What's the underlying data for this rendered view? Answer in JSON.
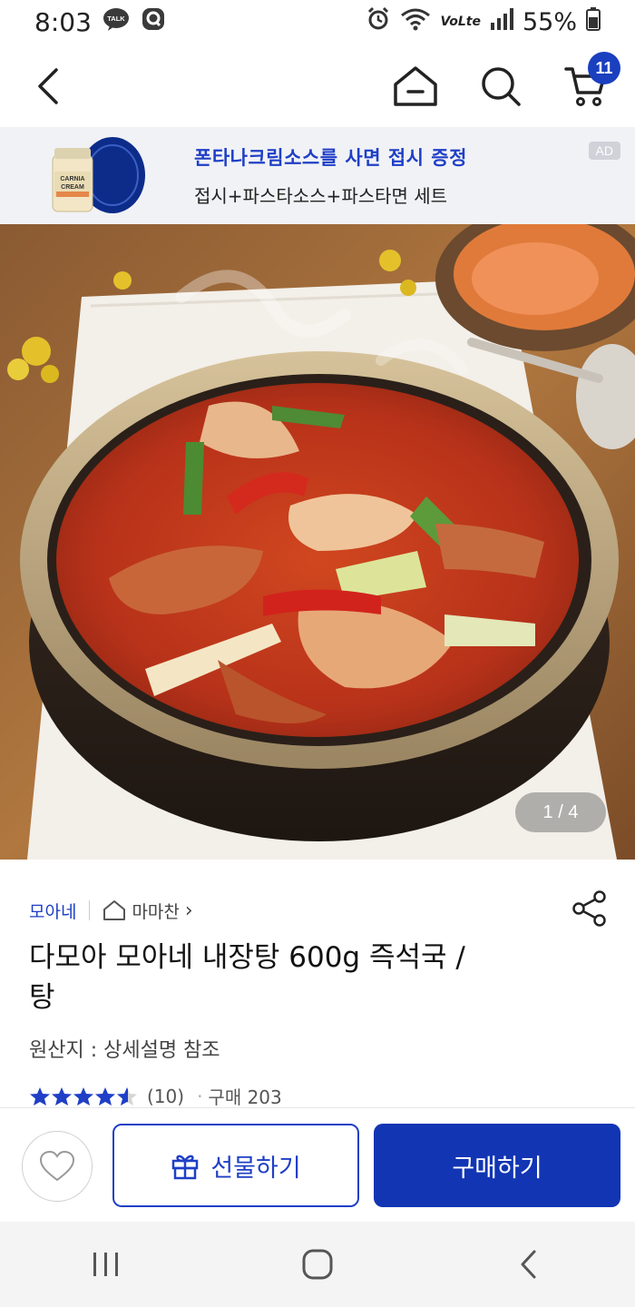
{
  "status_bar": {
    "time": "8:03",
    "talk_label": "TALK",
    "network": "VoLte",
    "battery": "55%"
  },
  "nav": {
    "back_icon": "chevron-left-icon",
    "home_icon": "home-icon",
    "search_icon": "search-icon",
    "cart_icon": "cart-icon",
    "cart_count": "11"
  },
  "ad": {
    "title": "폰타나크림소스를 사면 접시 증정",
    "subtitle": "접시+파스타소스+파스타면 세트",
    "tag": "AD",
    "jar_label_top": "CARNIA",
    "jar_label_bottom": "CREAM"
  },
  "hero": {
    "indicator": "1 / 4"
  },
  "product": {
    "brand": "모아네",
    "store": "마마찬",
    "store_arrow": "›",
    "title_line1": "다모아 모아네 내장탕 600g 즉석국 /",
    "title_line2": "탕",
    "origin": "원산지 : 상세설명 참조",
    "rating": 4.5,
    "review_count": "(10)",
    "purchase_label": "구매 203"
  },
  "actions": {
    "gift_label": "선물하기",
    "buy_label": "구매하기"
  },
  "colors": {
    "accent": "#1f3fc6",
    "buy_button": "#1235b4",
    "star": "#1f3fc6"
  }
}
